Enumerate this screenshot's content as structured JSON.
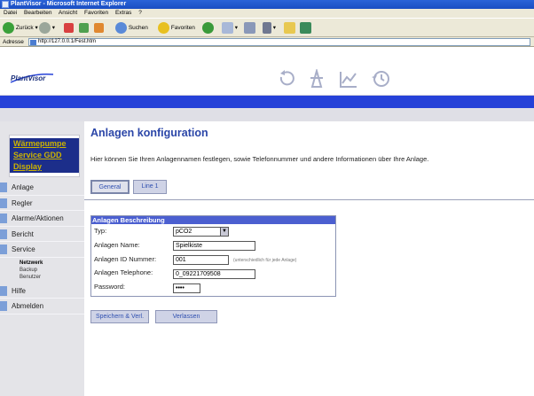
{
  "browser": {
    "title": "PlantVisor - Microsoft Internet Explorer",
    "menu": [
      "Datei",
      "Bearbeiten",
      "Ansicht",
      "Favoriten",
      "Extras",
      "?"
    ],
    "toolbar": {
      "back": "Zurück",
      "search": "Suchen",
      "favorites": "Favoriten"
    },
    "address_label": "Adresse",
    "address": "http://127.0.0.1/Fest.htm"
  },
  "header": {
    "logo": "PlantVisor",
    "nav_icons": [
      "refresh-icon",
      "tower-icon",
      "graph-icon",
      "history-icon"
    ]
  },
  "sidebar": {
    "top_links": [
      "Wärmepumpe",
      "Service GDD",
      "Display"
    ],
    "menu": [
      {
        "label": "Anlage"
      },
      {
        "label": "Regler"
      },
      {
        "label": "Alarme/Aktionen"
      },
      {
        "label": "Bericht"
      },
      {
        "label": "Service"
      }
    ],
    "submenu": [
      "Netzwerk",
      "Backup",
      "Benutzer"
    ],
    "menu_bottom": [
      {
        "label": "Hilfe"
      },
      {
        "label": "Abmelden"
      }
    ]
  },
  "main": {
    "title": "Anlagen konfiguration",
    "intro": "Hier können Sie Ihren Anlagennamen festlegen, sowie Telefonnummer und andere Informationen über Ihre Anlage.",
    "tabs": [
      "General",
      "Line 1"
    ],
    "fieldset_title": "Anlagen Beschreibung",
    "fields": {
      "typ_label": "Typ:",
      "typ_value": "pCO2",
      "name_label": "Anlagen Name:",
      "name_value": "Spielkiste",
      "id_label": "Anlagen ID Nummer:",
      "id_value": "001",
      "id_hint": "(unterschiedlich für jede Anlage)",
      "tel_label": "Anlagen Telephone:",
      "tel_value": "0_09221709508",
      "pw_label": "Password:",
      "pw_value": "••••"
    },
    "buttons": {
      "save": "Speichern & Verl.",
      "leave": "Verlassen"
    }
  }
}
